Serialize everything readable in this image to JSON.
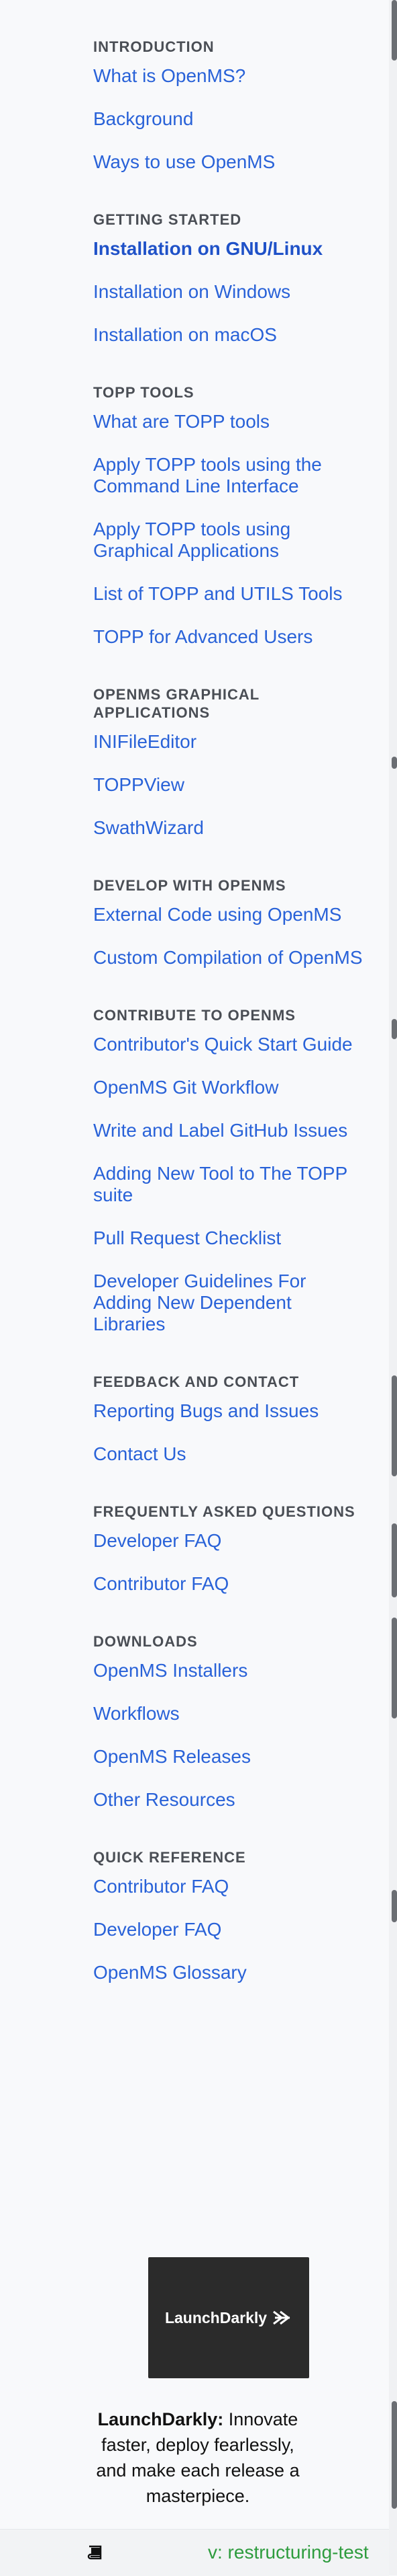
{
  "sidebar": {
    "sections": [
      {
        "caption": "INTRODUCTION",
        "links": [
          "What is OpenMS?",
          "Background",
          "Ways to use OpenMS"
        ]
      },
      {
        "caption": "GETTING STARTED",
        "links": [
          "Installation on GNU/Linux",
          "Installation on Windows",
          "Installation on macOS"
        ],
        "current_index": 0
      },
      {
        "caption": "TOPP TOOLS",
        "links": [
          "What are TOPP tools",
          "Apply TOPP tools using the Command Line Interface",
          "Apply TOPP tools using Graphical Applications",
          "List of TOPP and UTILS Tools",
          "TOPP for Advanced Users"
        ]
      },
      {
        "caption": "OPENMS GRAPHICAL APPLICATIONS",
        "links": [
          "INIFileEditor",
          "TOPPView",
          "SwathWizard"
        ]
      },
      {
        "caption": "DEVELOP WITH OPENMS",
        "links": [
          "External Code using OpenMS",
          "Custom Compilation of OpenMS"
        ]
      },
      {
        "caption": "CONTRIBUTE TO OPENMS",
        "links": [
          "Contributor's Quick Start Guide",
          "OpenMS Git Workflow",
          "Write and Label GitHub Issues",
          "Adding New Tool to The TOPP suite",
          "Pull Request Checklist",
          "Developer Guidelines For Adding New Dependent Libraries"
        ]
      },
      {
        "caption": "FEEDBACK AND CONTACT",
        "links": [
          "Reporting Bugs and Issues",
          "Contact Us"
        ]
      },
      {
        "caption": "FREQUENTLY ASKED QUESTIONS",
        "links": [
          "Developer FAQ",
          "Contributor FAQ"
        ]
      },
      {
        "caption": "DOWNLOADS",
        "links": [
          "OpenMS Installers",
          "Workflows",
          "OpenMS Releases",
          "Other Resources"
        ]
      },
      {
        "caption": "QUICK REFERENCE",
        "links": [
          "Contributor FAQ",
          "Developer FAQ",
          "OpenMS Glossary"
        ]
      }
    ]
  },
  "ad": {
    "logo_text": "LaunchDarkly",
    "headline": "LaunchDarkly:",
    "body": " Innovate faster, deploy fearlessly, and make each release a masterpiece."
  },
  "footer": {
    "icon": "book-icon",
    "version_label": "v: restructuring-test"
  },
  "colors": {
    "link": "#2962d8",
    "caption": "#4a4e55",
    "version": "#2e9c3e",
    "background": "#f8f9fb"
  }
}
